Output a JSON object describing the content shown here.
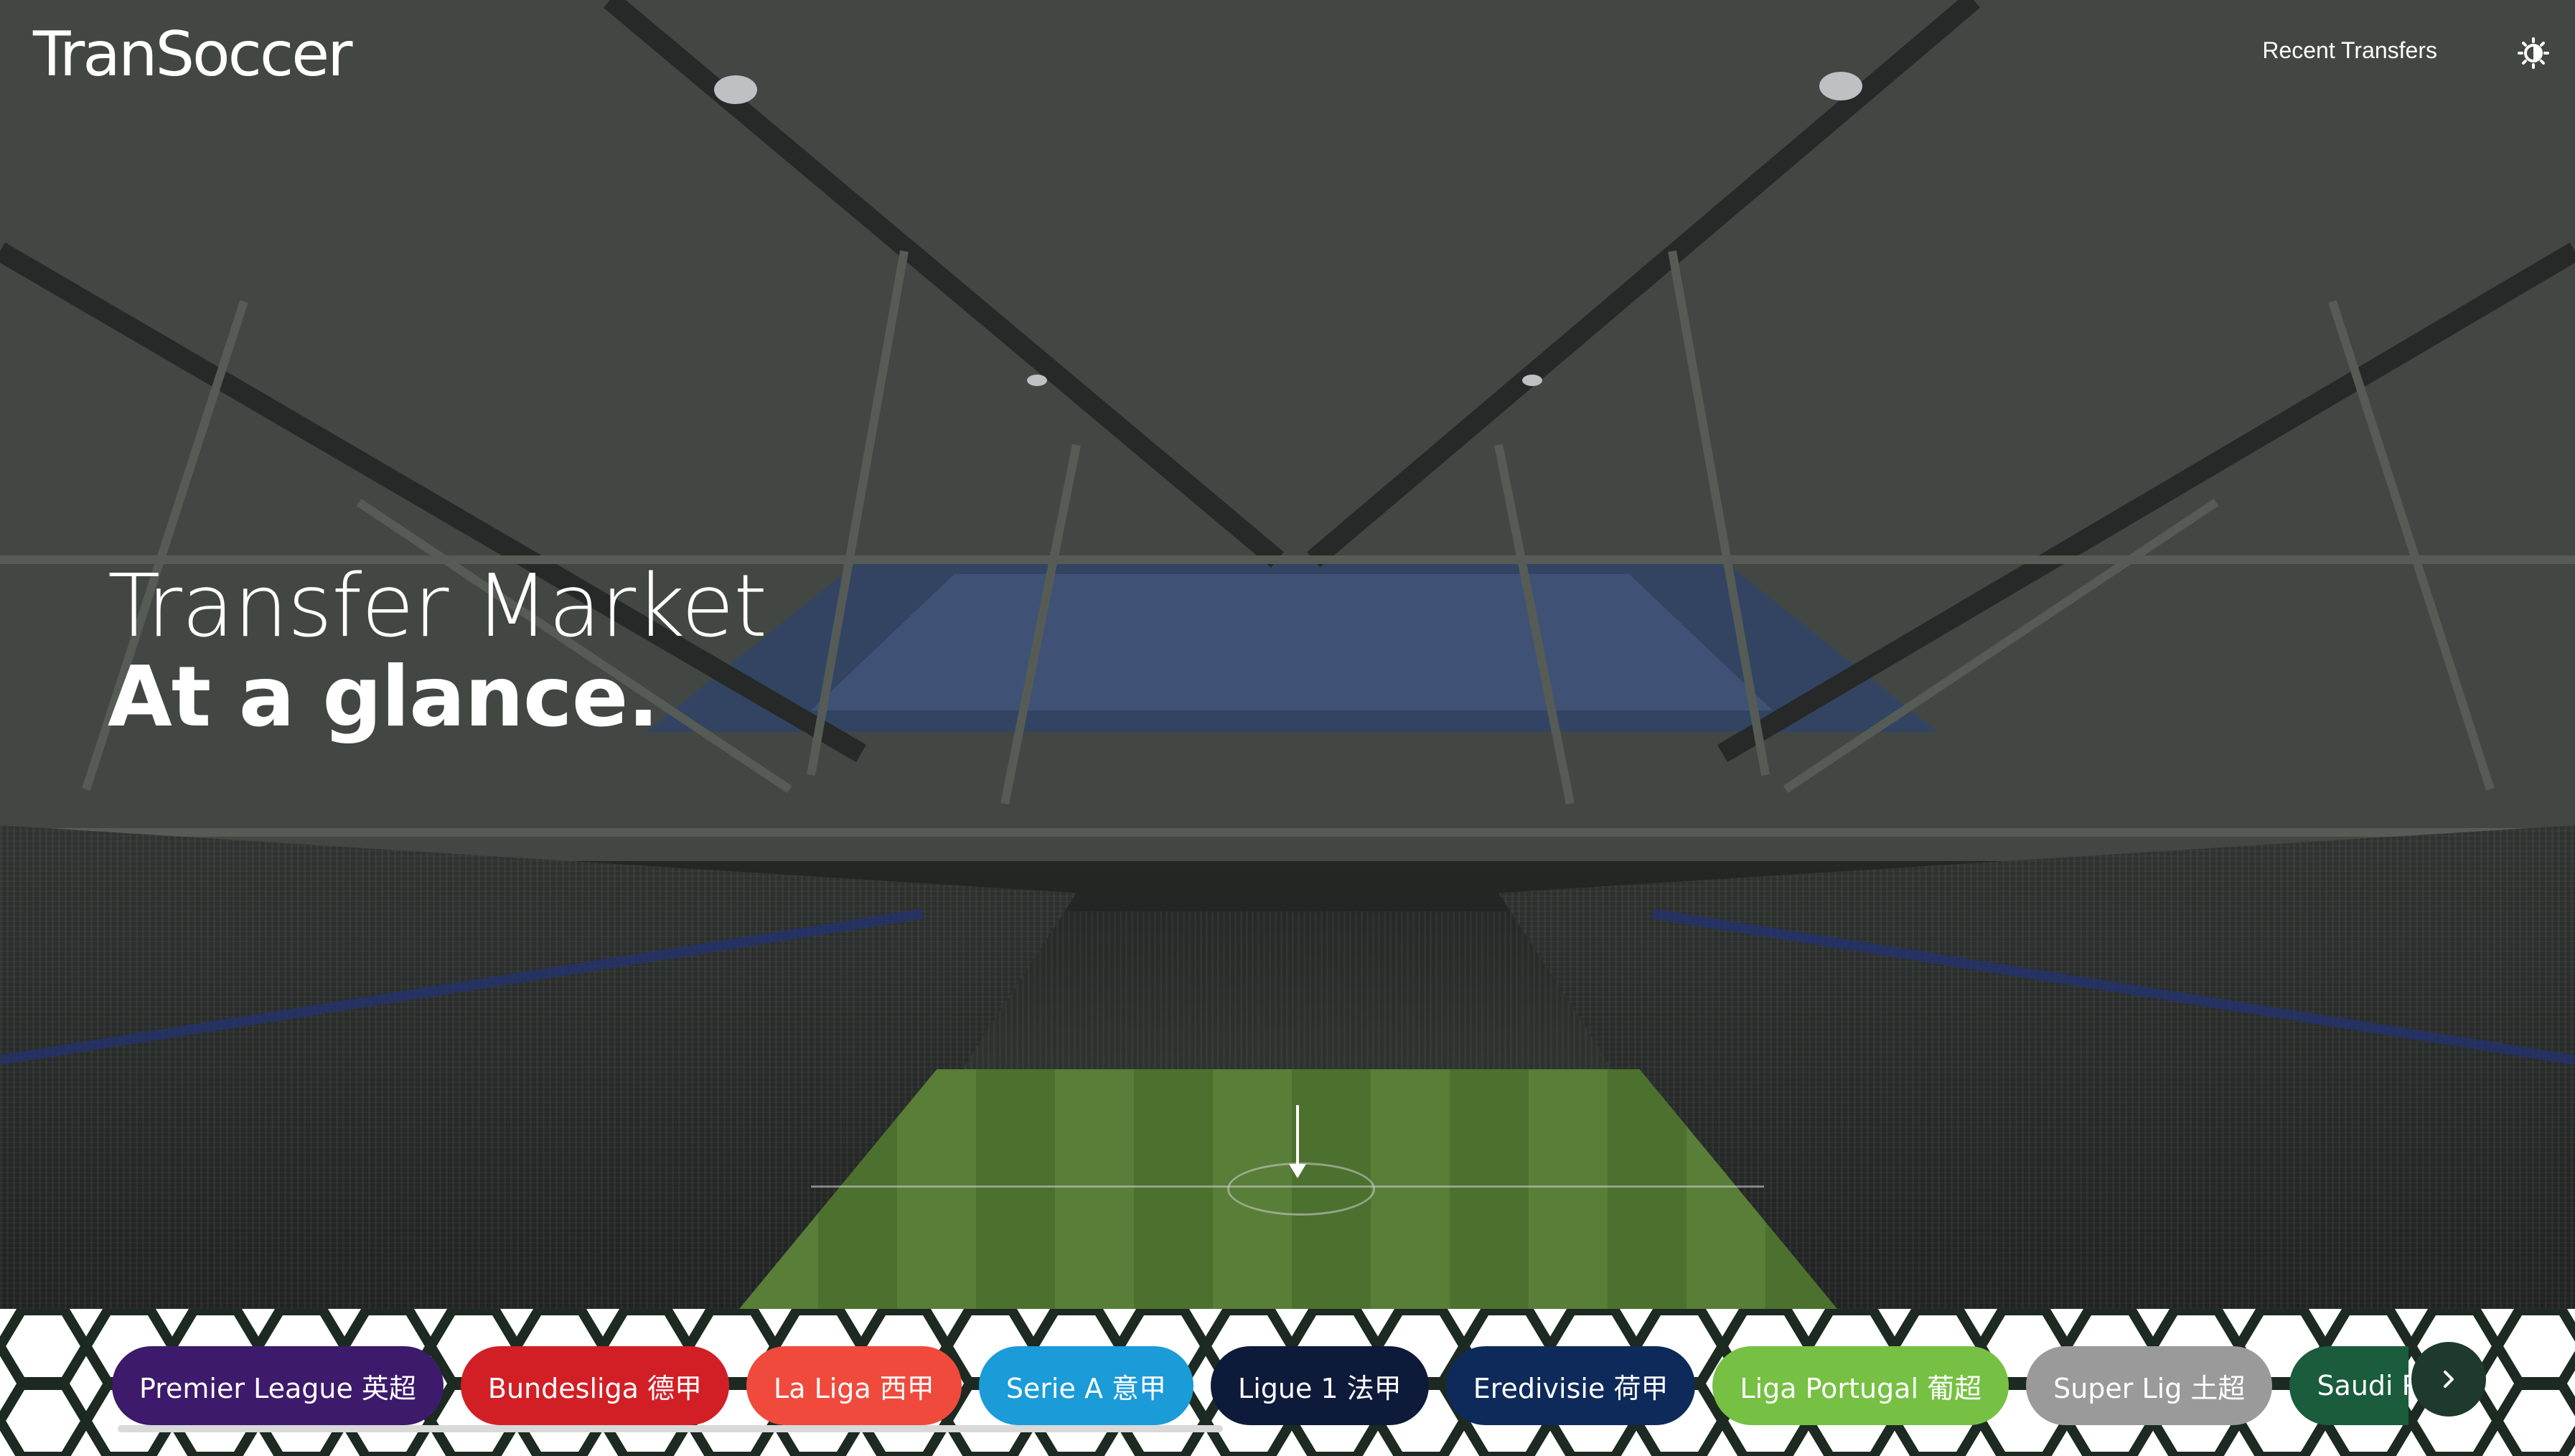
{
  "nav": {
    "logo": "TranSoccer",
    "recent_transfers": "Recent Transfers",
    "theme_toggle_icon": "brightness-icon"
  },
  "hero": {
    "title": "Transfer Market",
    "subtitle": "At a glance."
  },
  "leagues": {
    "items": [
      {
        "label": "Premier League 英超",
        "color": "#3d1a6b"
      },
      {
        "label": "Bundesliga 德甲",
        "color": "#d21f26"
      },
      {
        "label": "La Liga 西甲",
        "color": "#f04a3c"
      },
      {
        "label": "Serie A 意甲",
        "color": "#1b9bd8"
      },
      {
        "label": "Ligue 1 法甲",
        "color": "#0e1a3a"
      },
      {
        "label": "Eredivisie 荷甲",
        "color": "#0e2a5a"
      },
      {
        "label": "Liga Portugal 葡超",
        "color": "#76c043"
      },
      {
        "label": "Super Lig 土超",
        "color": "#9a9a9a"
      },
      {
        "label": "Saudi Pro League",
        "color": "#1a5c3c"
      }
    ],
    "next_icon": "chevron-right-icon"
  },
  "colors": {
    "next_button": "#1e3a2c",
    "accent_text": "#ffffff"
  }
}
